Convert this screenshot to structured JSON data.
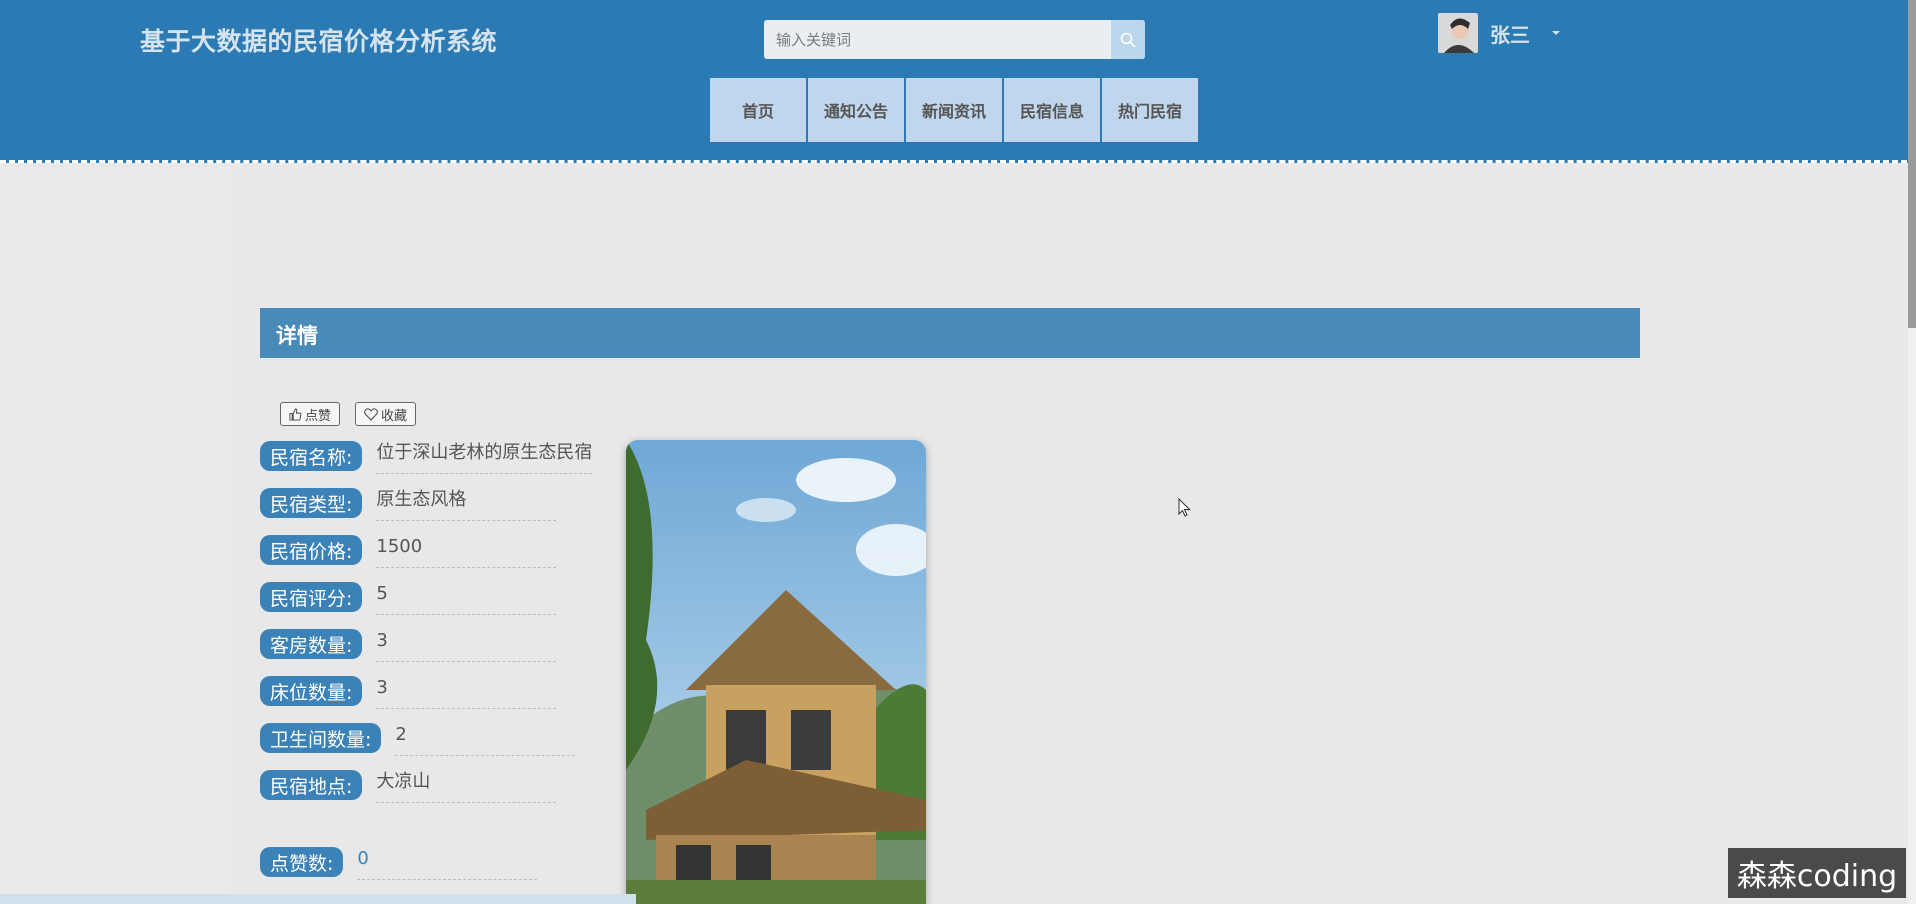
{
  "header": {
    "site_title": "基于大数据的民宿价格分析系统",
    "search_placeholder": "输入关键词",
    "username": "张三"
  },
  "nav": [
    "首页",
    "通知公告",
    "新闻资讯",
    "民宿信息",
    "热门民宿"
  ],
  "detail": {
    "section_title": "详情",
    "like_label": "点赞",
    "favorite_label": "收藏",
    "fields": [
      {
        "label": "民宿名称:",
        "value": "位于深山老林的原生态民宿"
      },
      {
        "label": "民宿类型:",
        "value": "原生态风格"
      },
      {
        "label": "民宿价格:",
        "value": "1500"
      },
      {
        "label": "民宿评分:",
        "value": "5"
      },
      {
        "label": "客房数量:",
        "value": "3"
      },
      {
        "label": "床位数量:",
        "value": "3"
      },
      {
        "label": "卫生间数量:",
        "value": "2"
      },
      {
        "label": "民宿地点:",
        "value": "大凉山"
      }
    ],
    "likes": {
      "label": "点赞数:",
      "value": "0"
    }
  },
  "watermark": "森森coding",
  "colors": {
    "header_bg": "#2c7ab3",
    "nav_bg": "#bfd6ec",
    "label_bg": "#3a82b7",
    "detail_bar": "#488ab8"
  }
}
